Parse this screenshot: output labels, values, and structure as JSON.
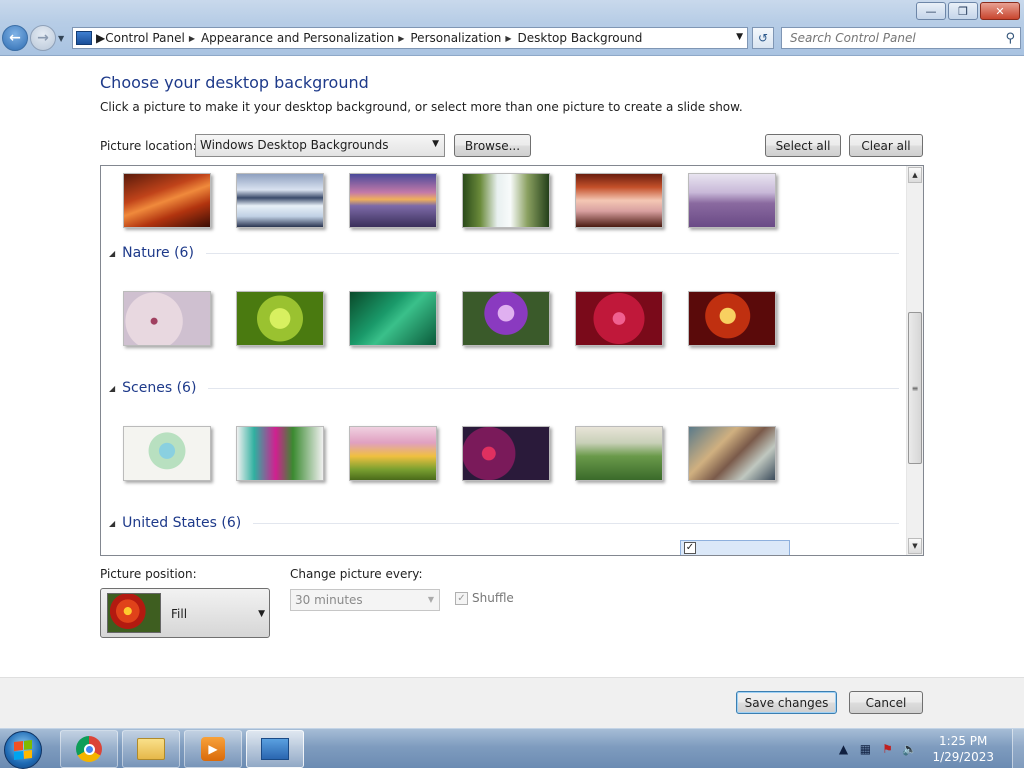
{
  "address_bar": {
    "breadcrumbs": [
      "Control Panel",
      "Appearance and Personalization",
      "Personalization",
      "Desktop Background"
    ]
  },
  "search": {
    "placeholder": "Search Control Panel"
  },
  "page": {
    "heading": "Choose your desktop background",
    "description": "Click a picture to make it your desktop background, or select more than one picture to create a slide show."
  },
  "location": {
    "label": "Picture location:",
    "value": "Windows Desktop Backgrounds",
    "browse_label": "Browse...",
    "select_all_label": "Select all",
    "clear_all_label": "Clear all"
  },
  "gallery": {
    "groups": [
      {
        "title": "Nature (6)"
      },
      {
        "title": "Scenes (6)"
      },
      {
        "title": "United States (6)"
      }
    ],
    "rows": [
      [
        "canyon-red",
        "ice-lake",
        "purple-coast",
        "waterfall",
        "arch-sunset",
        "lavender-field"
      ],
      [
        "white-bloom",
        "green-succulent",
        "green-leaves",
        "purple-thistle",
        "red-dahlia",
        "autumn-leaves"
      ],
      [
        "pastel-floral",
        "colorful-trees",
        "fantasy-landscape",
        "dark-bubbles",
        "green-meadow",
        "abstract-shapes"
      ]
    ]
  },
  "position": {
    "label": "Picture position:",
    "value": "Fill"
  },
  "interval": {
    "label": "Change picture every:",
    "value": "30 minutes"
  },
  "shuffle": {
    "label": "Shuffle",
    "checked": true,
    "enabled": false
  },
  "footer": {
    "save_label": "Save changes",
    "cancel_label": "Cancel"
  },
  "window_controls": {
    "minimize": "minimize-icon",
    "restore": "restore-icon",
    "close": "close-icon"
  },
  "taskbar": {
    "pinned": [
      "Google Chrome",
      "Windows Explorer",
      "Windows Media Player",
      "Control Panel"
    ],
    "clock_time": "1:25 PM",
    "clock_date": "1/29/2023"
  },
  "colors": {
    "accent_heading": "#1e3a8a",
    "selection": "#dbe8f8"
  }
}
